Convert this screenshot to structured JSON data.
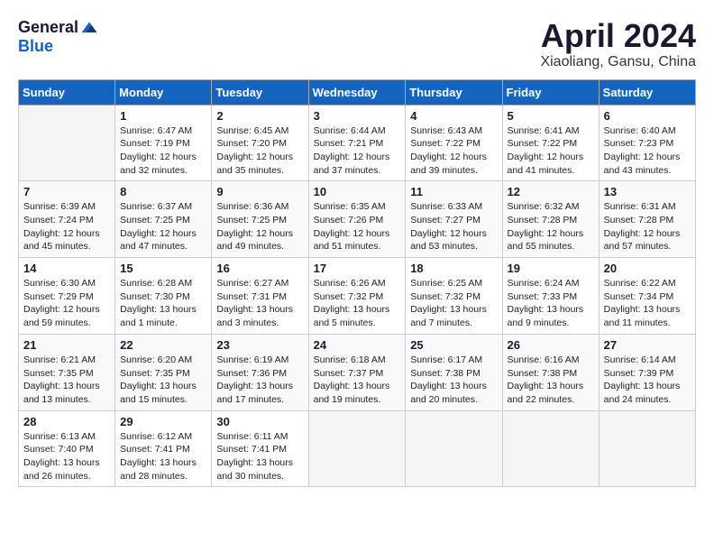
{
  "header": {
    "logo_general": "General",
    "logo_blue": "Blue",
    "month_title": "April 2024",
    "location": "Xiaoliang, Gansu, China"
  },
  "calendar": {
    "days_of_week": [
      "Sunday",
      "Monday",
      "Tuesday",
      "Wednesday",
      "Thursday",
      "Friday",
      "Saturday"
    ],
    "weeks": [
      [
        {
          "day": "",
          "sunrise": "",
          "sunset": "",
          "daylight": ""
        },
        {
          "day": "1",
          "sunrise": "Sunrise: 6:47 AM",
          "sunset": "Sunset: 7:19 PM",
          "daylight": "Daylight: 12 hours and 32 minutes."
        },
        {
          "day": "2",
          "sunrise": "Sunrise: 6:45 AM",
          "sunset": "Sunset: 7:20 PM",
          "daylight": "Daylight: 12 hours and 35 minutes."
        },
        {
          "day": "3",
          "sunrise": "Sunrise: 6:44 AM",
          "sunset": "Sunset: 7:21 PM",
          "daylight": "Daylight: 12 hours and 37 minutes."
        },
        {
          "day": "4",
          "sunrise": "Sunrise: 6:43 AM",
          "sunset": "Sunset: 7:22 PM",
          "daylight": "Daylight: 12 hours and 39 minutes."
        },
        {
          "day": "5",
          "sunrise": "Sunrise: 6:41 AM",
          "sunset": "Sunset: 7:22 PM",
          "daylight": "Daylight: 12 hours and 41 minutes."
        },
        {
          "day": "6",
          "sunrise": "Sunrise: 6:40 AM",
          "sunset": "Sunset: 7:23 PM",
          "daylight": "Daylight: 12 hours and 43 minutes."
        }
      ],
      [
        {
          "day": "7",
          "sunrise": "Sunrise: 6:39 AM",
          "sunset": "Sunset: 7:24 PM",
          "daylight": "Daylight: 12 hours and 45 minutes."
        },
        {
          "day": "8",
          "sunrise": "Sunrise: 6:37 AM",
          "sunset": "Sunset: 7:25 PM",
          "daylight": "Daylight: 12 hours and 47 minutes."
        },
        {
          "day": "9",
          "sunrise": "Sunrise: 6:36 AM",
          "sunset": "Sunset: 7:25 PM",
          "daylight": "Daylight: 12 hours and 49 minutes."
        },
        {
          "day": "10",
          "sunrise": "Sunrise: 6:35 AM",
          "sunset": "Sunset: 7:26 PM",
          "daylight": "Daylight: 12 hours and 51 minutes."
        },
        {
          "day": "11",
          "sunrise": "Sunrise: 6:33 AM",
          "sunset": "Sunset: 7:27 PM",
          "daylight": "Daylight: 12 hours and 53 minutes."
        },
        {
          "day": "12",
          "sunrise": "Sunrise: 6:32 AM",
          "sunset": "Sunset: 7:28 PM",
          "daylight": "Daylight: 12 hours and 55 minutes."
        },
        {
          "day": "13",
          "sunrise": "Sunrise: 6:31 AM",
          "sunset": "Sunset: 7:28 PM",
          "daylight": "Daylight: 12 hours and 57 minutes."
        }
      ],
      [
        {
          "day": "14",
          "sunrise": "Sunrise: 6:30 AM",
          "sunset": "Sunset: 7:29 PM",
          "daylight": "Daylight: 12 hours and 59 minutes."
        },
        {
          "day": "15",
          "sunrise": "Sunrise: 6:28 AM",
          "sunset": "Sunset: 7:30 PM",
          "daylight": "Daylight: 13 hours and 1 minute."
        },
        {
          "day": "16",
          "sunrise": "Sunrise: 6:27 AM",
          "sunset": "Sunset: 7:31 PM",
          "daylight": "Daylight: 13 hours and 3 minutes."
        },
        {
          "day": "17",
          "sunrise": "Sunrise: 6:26 AM",
          "sunset": "Sunset: 7:32 PM",
          "daylight": "Daylight: 13 hours and 5 minutes."
        },
        {
          "day": "18",
          "sunrise": "Sunrise: 6:25 AM",
          "sunset": "Sunset: 7:32 PM",
          "daylight": "Daylight: 13 hours and 7 minutes."
        },
        {
          "day": "19",
          "sunrise": "Sunrise: 6:24 AM",
          "sunset": "Sunset: 7:33 PM",
          "daylight": "Daylight: 13 hours and 9 minutes."
        },
        {
          "day": "20",
          "sunrise": "Sunrise: 6:22 AM",
          "sunset": "Sunset: 7:34 PM",
          "daylight": "Daylight: 13 hours and 11 minutes."
        }
      ],
      [
        {
          "day": "21",
          "sunrise": "Sunrise: 6:21 AM",
          "sunset": "Sunset: 7:35 PM",
          "daylight": "Daylight: 13 hours and 13 minutes."
        },
        {
          "day": "22",
          "sunrise": "Sunrise: 6:20 AM",
          "sunset": "Sunset: 7:35 PM",
          "daylight": "Daylight: 13 hours and 15 minutes."
        },
        {
          "day": "23",
          "sunrise": "Sunrise: 6:19 AM",
          "sunset": "Sunset: 7:36 PM",
          "daylight": "Daylight: 13 hours and 17 minutes."
        },
        {
          "day": "24",
          "sunrise": "Sunrise: 6:18 AM",
          "sunset": "Sunset: 7:37 PM",
          "daylight": "Daylight: 13 hours and 19 minutes."
        },
        {
          "day": "25",
          "sunrise": "Sunrise: 6:17 AM",
          "sunset": "Sunset: 7:38 PM",
          "daylight": "Daylight: 13 hours and 20 minutes."
        },
        {
          "day": "26",
          "sunrise": "Sunrise: 6:16 AM",
          "sunset": "Sunset: 7:38 PM",
          "daylight": "Daylight: 13 hours and 22 minutes."
        },
        {
          "day": "27",
          "sunrise": "Sunrise: 6:14 AM",
          "sunset": "Sunset: 7:39 PM",
          "daylight": "Daylight: 13 hours and 24 minutes."
        }
      ],
      [
        {
          "day": "28",
          "sunrise": "Sunrise: 6:13 AM",
          "sunset": "Sunset: 7:40 PM",
          "daylight": "Daylight: 13 hours and 26 minutes."
        },
        {
          "day": "29",
          "sunrise": "Sunrise: 6:12 AM",
          "sunset": "Sunset: 7:41 PM",
          "daylight": "Daylight: 13 hours and 28 minutes."
        },
        {
          "day": "30",
          "sunrise": "Sunrise: 6:11 AM",
          "sunset": "Sunset: 7:41 PM",
          "daylight": "Daylight: 13 hours and 30 minutes."
        },
        {
          "day": "",
          "sunrise": "",
          "sunset": "",
          "daylight": ""
        },
        {
          "day": "",
          "sunrise": "",
          "sunset": "",
          "daylight": ""
        },
        {
          "day": "",
          "sunrise": "",
          "sunset": "",
          "daylight": ""
        },
        {
          "day": "",
          "sunrise": "",
          "sunset": "",
          "daylight": ""
        }
      ]
    ]
  }
}
